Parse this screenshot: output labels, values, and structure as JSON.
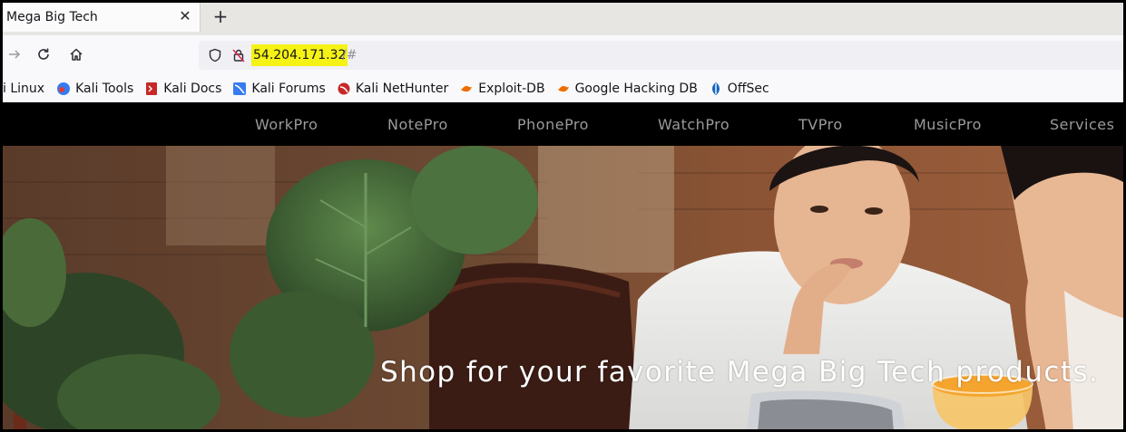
{
  "browser": {
    "tab": {
      "title": "Mega Big Tech",
      "close_icon": "close-icon"
    },
    "new_tab_icon": "plus-icon",
    "nav": {
      "forward_icon": "arrow-right-icon",
      "reload_icon": "reload-icon",
      "home_icon": "home-icon"
    },
    "url": {
      "host": "54.204.171.32",
      "rest": "/#",
      "shield_icon": "shield-icon",
      "insecure_icon": "insecure-lock-icon",
      "highlight_color": "#f5f215"
    },
    "bookmarks": [
      {
        "label": "i Linux",
        "icon": ""
      },
      {
        "label": "Kali Tools",
        "icon": "kali-tools-icon"
      },
      {
        "label": "Kali Docs",
        "icon": "kali-docs-icon"
      },
      {
        "label": "Kali Forums",
        "icon": "kali-forums-icon"
      },
      {
        "label": "Kali NetHunter",
        "icon": "kali-nethunter-icon"
      },
      {
        "label": "Exploit-DB",
        "icon": "exploit-db-icon"
      },
      {
        "label": "Google Hacking DB",
        "icon": "ghdb-icon"
      },
      {
        "label": "OffSec",
        "icon": "offsec-icon"
      }
    ]
  },
  "site": {
    "nav": [
      "WorkPro",
      "NotePro",
      "PhonePro",
      "WatchPro",
      "TVPro",
      "MusicPro",
      "Services"
    ],
    "hero_text": "Shop for your favorite Mega Big Tech products."
  }
}
